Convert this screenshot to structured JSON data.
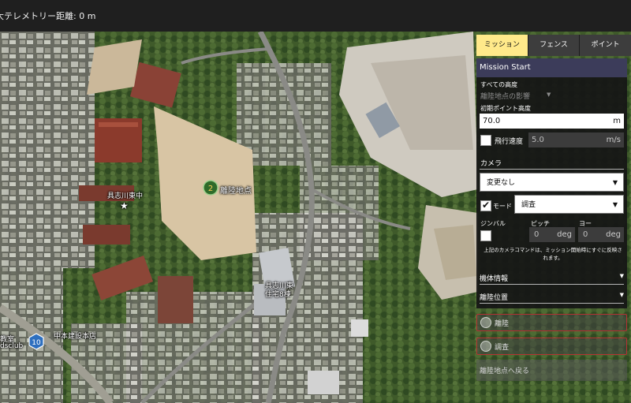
{
  "topbar": {
    "telemetry": "大テレメトリー距離:  0 m"
  },
  "map": {
    "takeoff_marker": {
      "number": "2",
      "label": "離陸地点"
    },
    "labels": {
      "school": "具志川東中",
      "housing": "具志川東\n住宅8棟",
      "shop": "中本建設本店",
      "edge1": "教室",
      "edge2": "dsclub"
    },
    "road_badge": "10"
  },
  "tabs": [
    {
      "label": "ミッション",
      "active": true
    },
    {
      "label": "フェンス",
      "active": false
    },
    {
      "label": "ポイント",
      "active": false
    }
  ],
  "panel": {
    "title": "Mission Start",
    "all_altitude": "すべての高度",
    "takeoff_influence": "離陸地点の影響",
    "initial_altitude_label": "初期ポイント高度",
    "initial_altitude": {
      "value": "70.0",
      "unit": "m"
    },
    "flight_speed": {
      "label": "飛行速度",
      "value": "5.0",
      "unit": "m/s",
      "checked": false
    },
    "camera_label": "カメラ",
    "camera_select": "変更なし",
    "mode": {
      "label": "モード",
      "checked": true,
      "value": "調査"
    },
    "gimbal": {
      "label": "ジンバル",
      "checked": false,
      "pitch_label": "ピッチ",
      "pitch": {
        "value": "0",
        "unit": "deg"
      },
      "yaw_label": "ヨー",
      "yaw": {
        "value": "0",
        "unit": "deg"
      }
    },
    "note": "上記のカメラコマンドは、ミッション開始時にすぐに反映されます。",
    "vehicle_info": "機体情報",
    "takeoff_position": "離陸位置"
  },
  "mission_items": [
    {
      "label": "離陸"
    },
    {
      "label": "調査"
    }
  ],
  "return_button": "離陸地点へ戻る"
}
